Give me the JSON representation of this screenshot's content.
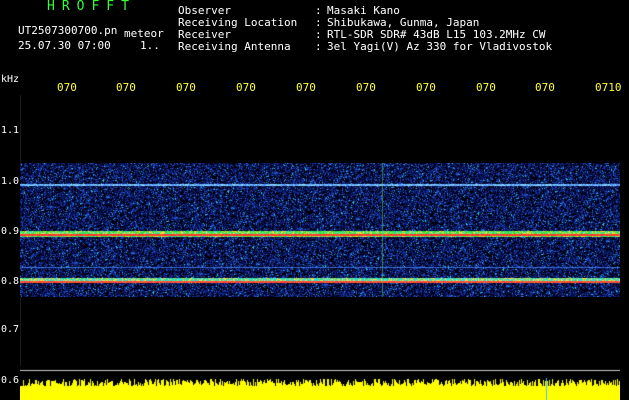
{
  "logo": "HROFFT",
  "file": {
    "name": "UT2507300700.pn",
    "type": "meteor",
    "date": "25.07.30 07:00",
    "sub": "1.."
  },
  "header": {
    "rows": [
      {
        "label": "Observer",
        "value": "Masaki Kano"
      },
      {
        "label": "Receiving Location",
        "value": "Shibukawa, Gunma, Japan"
      },
      {
        "label": "Receiver",
        "value": "RTL-SDR SDR# 43dB L15 103.2MHz CW"
      },
      {
        "label": "Receiving Antenna",
        "value": "3el Yagi(V) Az 330 for Vladivostok"
      }
    ]
  },
  "axis": {
    "unit": "kHz",
    "time_ticks": [
      "070",
      "070",
      "070",
      "070",
      "070",
      "070",
      "070",
      "070",
      "070",
      "0710"
    ],
    "freq_ticks": [
      "1.1",
      "1.0",
      "0.9",
      "0.8",
      "0.7",
      "0.6"
    ]
  },
  "colors": {
    "label_green": "#33ff33",
    "text_white": "#ffffff",
    "tick_yellow": "#ffff33",
    "noise_blue": "#1a3aa8",
    "signal_red": "#ff3030",
    "audio_yellow": "#ffff00"
  }
}
